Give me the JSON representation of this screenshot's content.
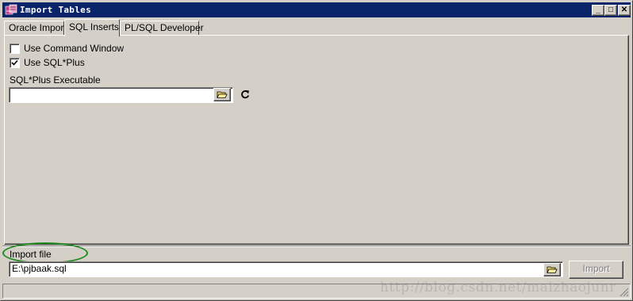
{
  "window": {
    "title": "Import Tables",
    "minimize_label": "_",
    "maximize_label": "□",
    "close_label": "✕"
  },
  "tabs": [
    {
      "label": "Oracle Import",
      "active": false
    },
    {
      "label": "SQL Inserts",
      "active": true
    },
    {
      "label": "PL/SQL Developer",
      "active": false
    }
  ],
  "sql_inserts": {
    "use_command_window": {
      "label": "Use Command Window",
      "checked": false
    },
    "use_sqlplus": {
      "label": "Use SQL*Plus",
      "checked": true
    },
    "sqlplus_executable": {
      "label": "SQL*Plus Executable",
      "value": ""
    }
  },
  "import_file": {
    "label": "Import file",
    "value": "E:\\pjbaak.sql"
  },
  "buttons": {
    "import_label": "Import",
    "import_enabled": false
  },
  "watermark": "http://blog.csdn.net/maizhaojunr",
  "colors": {
    "title_bar": "#0a246a",
    "dialog_face": "#d4d0c8",
    "annotation_circle": "#1e8a1e"
  }
}
